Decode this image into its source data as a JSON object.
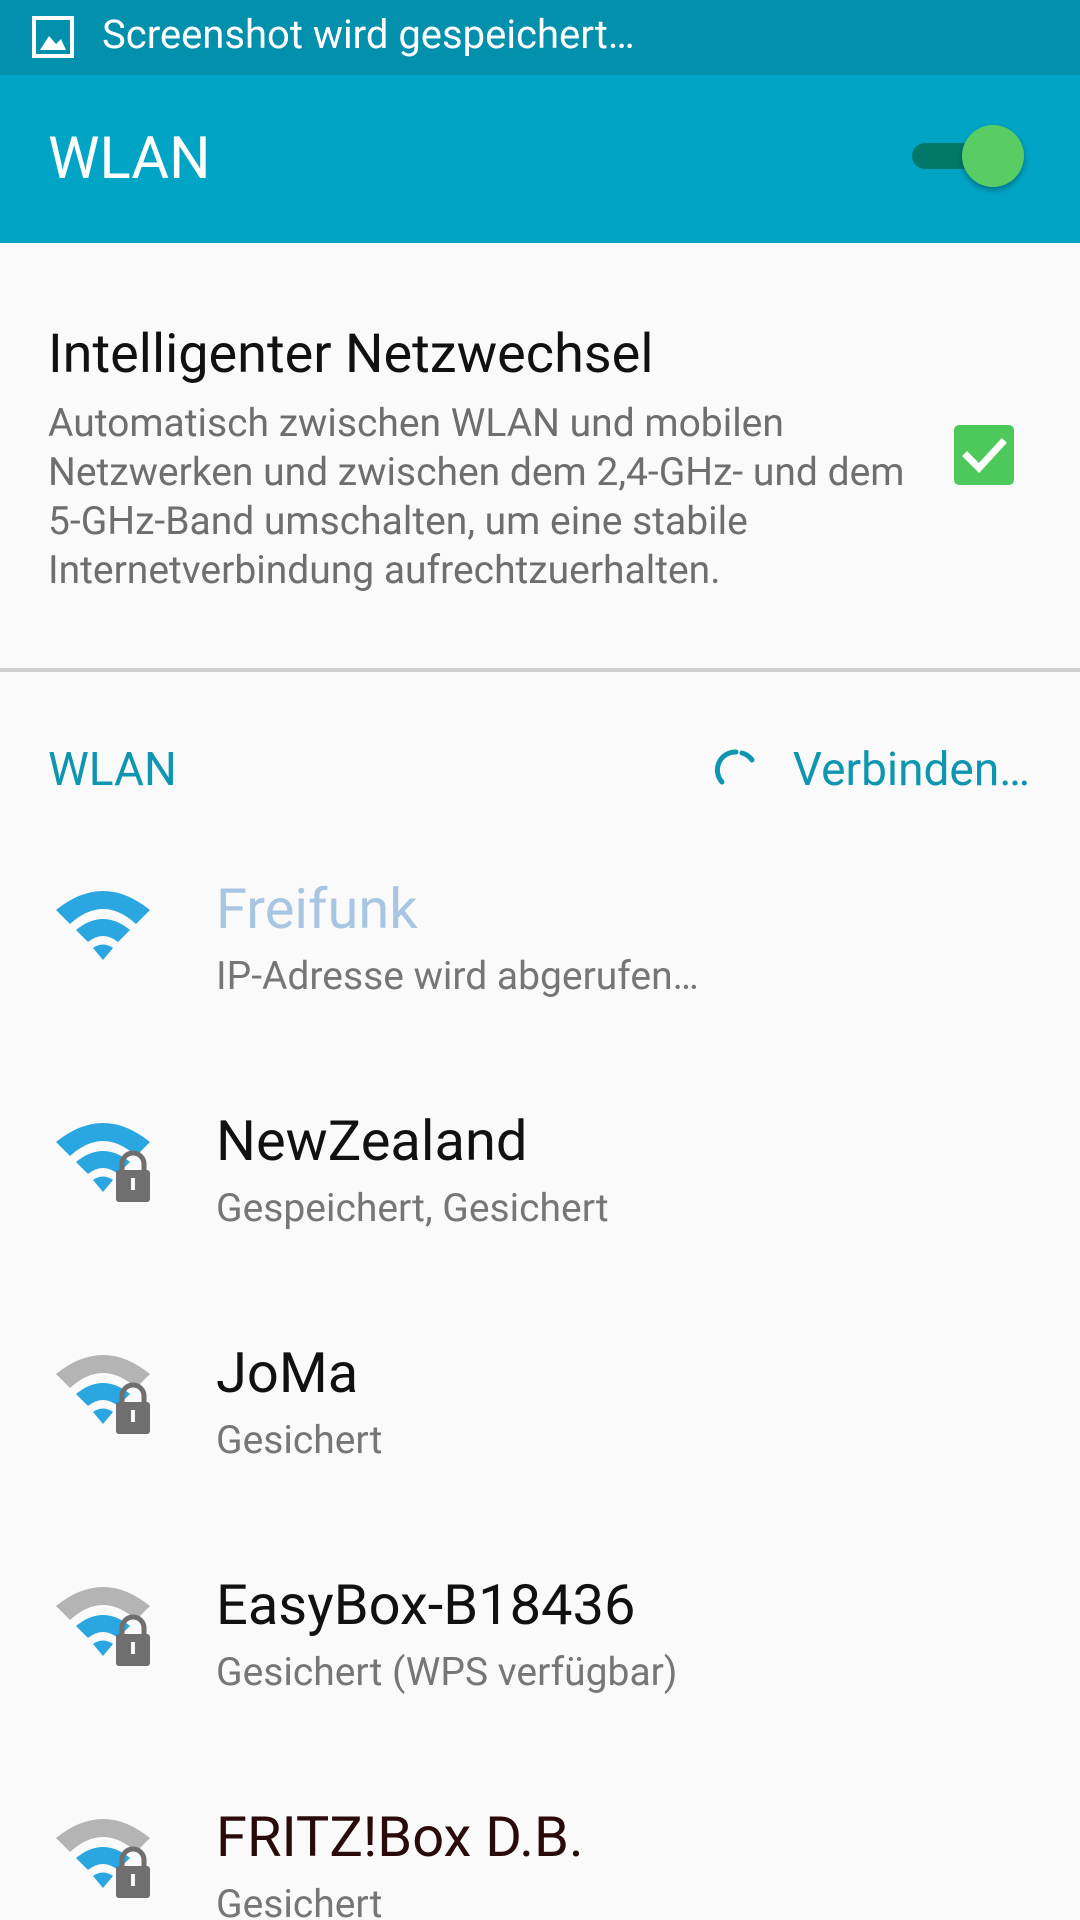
{
  "status_bar": {
    "icon": "screenshot-icon",
    "text": "Screenshot wird gespeichert…"
  },
  "app_bar": {
    "title": "WLAN",
    "toggle_on": true,
    "toggle_color": "#57cd64"
  },
  "smart_switch": {
    "title": "Intelligenter Netzwechsel",
    "description": "Automatisch zwischen WLAN und mobilen Netzwerken und zwischen dem 2,4-GHz- und dem 5-GHz-Band umschalten, um eine stabile Internetverbindung aufrechtzuerhalten.",
    "checked": true
  },
  "section": {
    "label": "WLAN",
    "status": "Verbinden…"
  },
  "colors": {
    "accent": "#00a4c4",
    "status_bar": "#0390ad",
    "checkbox": "#4cc95a",
    "wifi_blue": "#2aa6e0",
    "wifi_weak": "#b4b4b4"
  },
  "networks": [
    {
      "name": "Freifunk",
      "status": "IP-Adresse wird abgerufen…",
      "secured": false,
      "signal": "full",
      "connecting": true
    },
    {
      "name": "NewZealand",
      "status": "Gespeichert, Gesichert",
      "secured": true,
      "signal": "full",
      "connecting": false
    },
    {
      "name": "JoMa",
      "status": "Gesichert",
      "secured": true,
      "signal": "medium",
      "connecting": false
    },
    {
      "name": "EasyBox-B18436",
      "status": "Gesichert (WPS verfügbar)",
      "secured": true,
      "signal": "medium",
      "connecting": false
    },
    {
      "name": "FRITZ!Box D.B.",
      "status": "Gesichert",
      "secured": true,
      "signal": "medium",
      "connecting": false
    }
  ]
}
